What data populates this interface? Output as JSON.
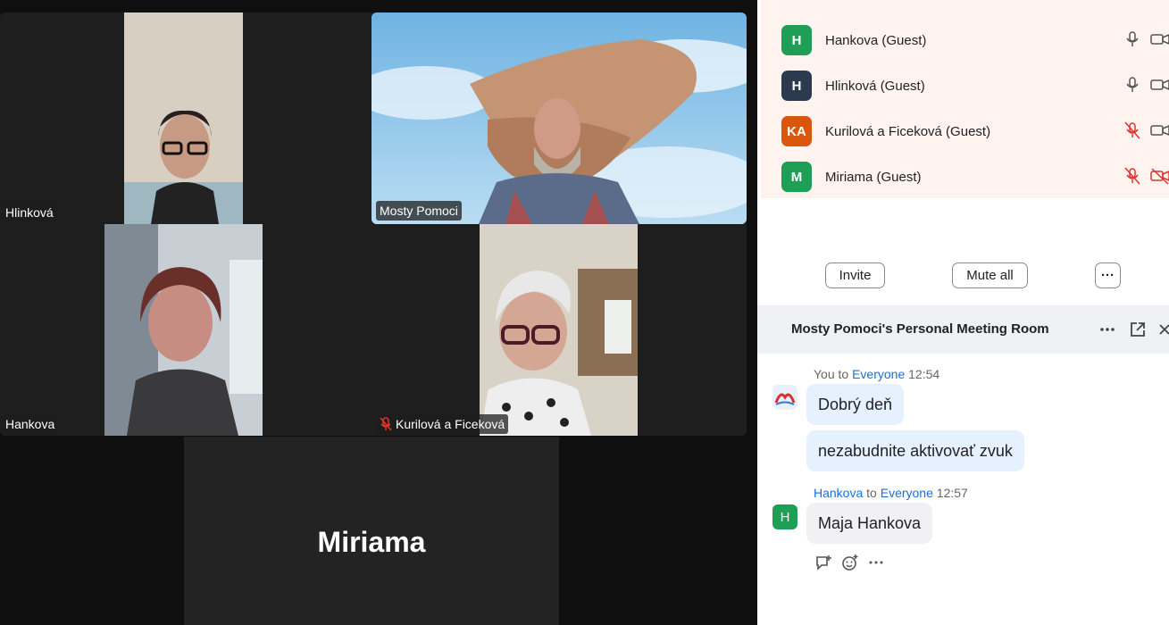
{
  "tiles": [
    {
      "name": "Hlinková",
      "muted": false
    },
    {
      "name": "Mosty Pomoci",
      "muted": false
    },
    {
      "name": "Hankova",
      "muted": false
    },
    {
      "name": "Kurilová a Ficeková",
      "muted": true
    }
  ],
  "bottom_tile": {
    "name": "Miriama"
  },
  "participants": [
    {
      "initials": "H",
      "name": "Hankova (Guest)",
      "color": "#1f9e56",
      "mic": "on",
      "cam": "on"
    },
    {
      "initials": "H",
      "name": "Hlinková (Guest)",
      "color": "#2b3a4f",
      "mic": "on",
      "cam": "on"
    },
    {
      "initials": "KA",
      "name": "Kurilová a Ficeková (Guest)",
      "color": "#d9560e",
      "mic": "muted",
      "cam": "on"
    },
    {
      "initials": "M",
      "name": "Miriama (Guest)",
      "color": "#1f9e56",
      "mic": "muted",
      "cam": "off"
    }
  ],
  "participant_buttons": {
    "invite": "Invite",
    "mute_all": "Mute all",
    "more": "···"
  },
  "chat": {
    "title": "Mosty Pomoci's Personal Meeting Room",
    "messages": [
      {
        "sender": "You",
        "to_word": "to",
        "recipient": "Everyone",
        "time": "12:54",
        "lines": [
          "Dobrý deň",
          "nezabudnite aktivovať zvuk"
        ]
      },
      {
        "sender": "Hankova",
        "to_word": "to",
        "recipient": "Everyone",
        "time": "12:57",
        "initial": "H",
        "lines": [
          "Maja Hankova"
        ]
      }
    ]
  },
  "colors": {
    "active_speaker": "#2ecc71",
    "link_blue": "#1a6fd6",
    "muted_red": "#e0322d"
  }
}
